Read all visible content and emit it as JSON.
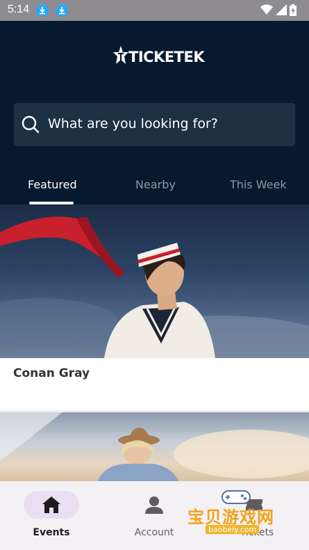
{
  "status_bar": {
    "time": "5:14"
  },
  "header": {
    "logo_text": "TICKETEK"
  },
  "search": {
    "placeholder": "What are you looking for?"
  },
  "tabs": [
    {
      "label": "Featured",
      "active": true
    },
    {
      "label": "Nearby",
      "active": false
    },
    {
      "label": "This Week",
      "active": false
    }
  ],
  "events": [
    {
      "title": "Conan Gray"
    },
    {
      "title": ""
    }
  ],
  "bottom_nav": [
    {
      "label": "Events",
      "icon": "home-icon",
      "active": true
    },
    {
      "label": "Account",
      "icon": "person-icon",
      "active": false
    },
    {
      "label": "Tickets",
      "icon": "ticket-icon",
      "active": false
    }
  ],
  "watermark": {
    "text": "宝贝游戏网",
    "url": "baobeiy.com"
  },
  "colors": {
    "header_bg": "#06192f",
    "search_bg": "#1d3044",
    "nav_bg": "#f3f1f4",
    "nav_active_pill": "#e8dff3",
    "status_bar_bg": "#8e8c90",
    "download_badge": "#2aa7f5"
  }
}
